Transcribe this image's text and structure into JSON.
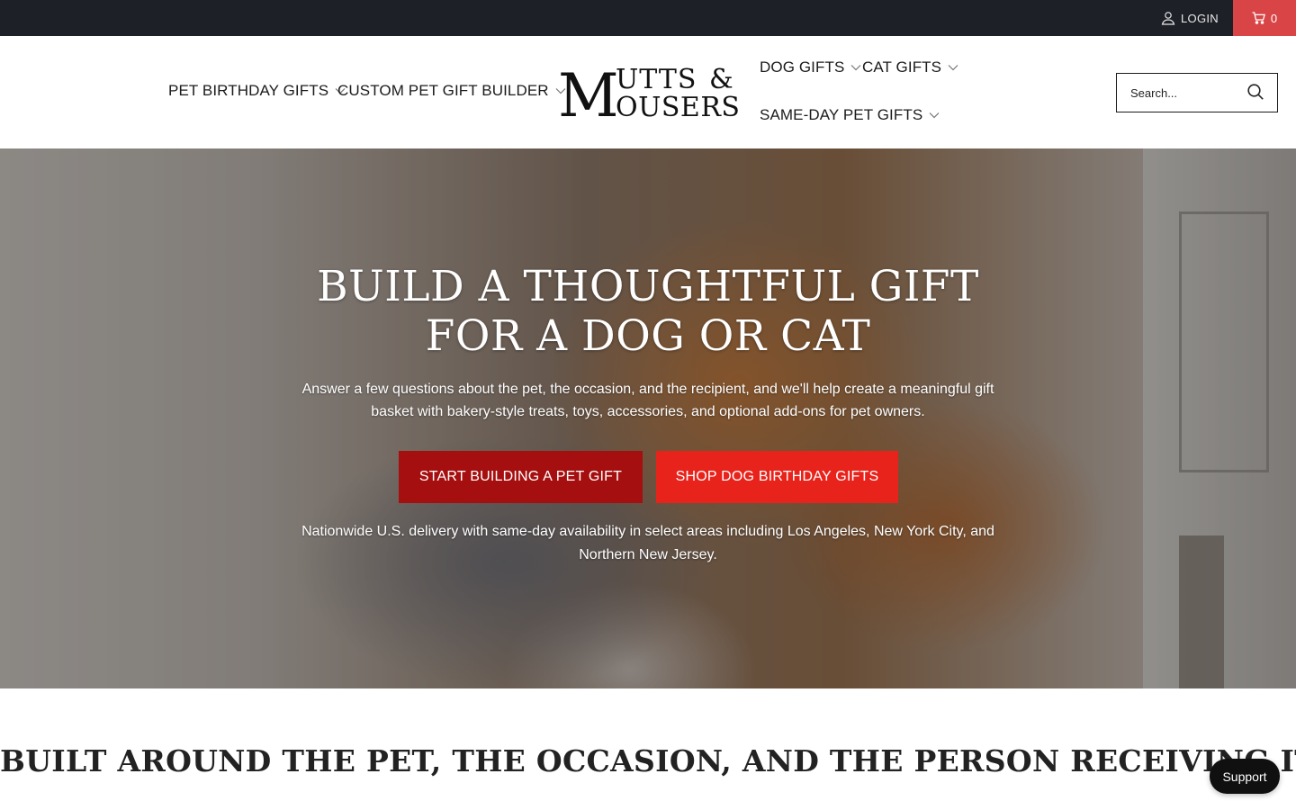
{
  "topbar": {
    "login_label": "LOGIN",
    "cart_count": "0",
    "cart_bg_color": "#d94546",
    "bg_color": "#1d2027"
  },
  "nav": {
    "left_items": [
      {
        "label": "PET BIRTHDAY GIFTS"
      },
      {
        "label": "CUSTOM PET GIFT BUILDER"
      }
    ],
    "right_items": [
      {
        "label": "DOG GIFTS"
      },
      {
        "label": "CAT GIFTS"
      },
      {
        "label": "SAME-DAY PET GIFTS"
      }
    ]
  },
  "logo": {
    "text_m": "M",
    "text_utts": "UTTS",
    "text_amp": "&",
    "text_ousers": "OUSERS"
  },
  "search": {
    "placeholder": "Search..."
  },
  "hero": {
    "title": "BUILD A THOUGHTFUL GIFT FOR A DOG OR CAT",
    "subtitle": "Answer a few questions about the pet, the occasion, and the recipient, and we'll help create a meaningful gift basket with bakery-style treats, toys, accessories, and optional add-ons for pet owners.",
    "primary_button": "START BUILDING A PET GIFT",
    "secondary_button": "SHOP DOG BIRTHDAY GIFTS",
    "note": "Nationwide U.S. delivery with same-day availability in select areas including Los Angeles, New York City, and Northern New Jersey.",
    "primary_color": "#a60f0f",
    "secondary_color": "#e8231b"
  },
  "section": {
    "title": "BUILT AROUND THE PET, THE OCCASION, AND THE PERSON RECEIVING IT"
  },
  "support": {
    "label": "Support"
  }
}
